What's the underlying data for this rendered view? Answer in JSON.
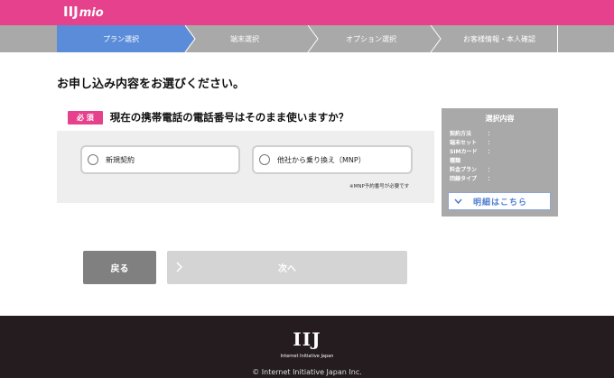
{
  "header": {
    "logo_main": "IIJ",
    "logo_sub": "mio",
    "bg_color": "#e6418c"
  },
  "steps": [
    {
      "label": "プラン選択",
      "active": true
    },
    {
      "label": "端末選択",
      "active": false
    },
    {
      "label": "オプション選択",
      "active": false
    },
    {
      "label": "お客様情報・本人確認",
      "active": false
    }
  ],
  "main": {
    "page_title": "お申し込み内容をお選びください。",
    "question": {
      "badge": "必 須",
      "text": "現在の携帯電話の電話番号はそのまま使いますか？",
      "options": [
        {
          "label": "新規契約"
        },
        {
          "label": "他社から乗り換え（MNP）"
        }
      ],
      "note": "※MNP予約番号が必要です"
    }
  },
  "summary": {
    "title": "選択内容",
    "rows": [
      {
        "key": "契約方法",
        "colon": "："
      },
      {
        "key": "端末セット",
        "colon": "："
      },
      {
        "key": "SIMカード",
        "colon": "："
      },
      {
        "key": "種類",
        "colon": ""
      },
      {
        "key": "料金プラン",
        "colon": "："
      },
      {
        "key": "回線タイプ",
        "colon": "："
      }
    ],
    "detail_button": "明細はこちら"
  },
  "buttons": {
    "back": "戻る",
    "next": "次へ"
  },
  "footer": {
    "logo": "IIJ",
    "company": "Internet Initiative Japan",
    "copyright": "© Internet Initiative Japan Inc."
  }
}
